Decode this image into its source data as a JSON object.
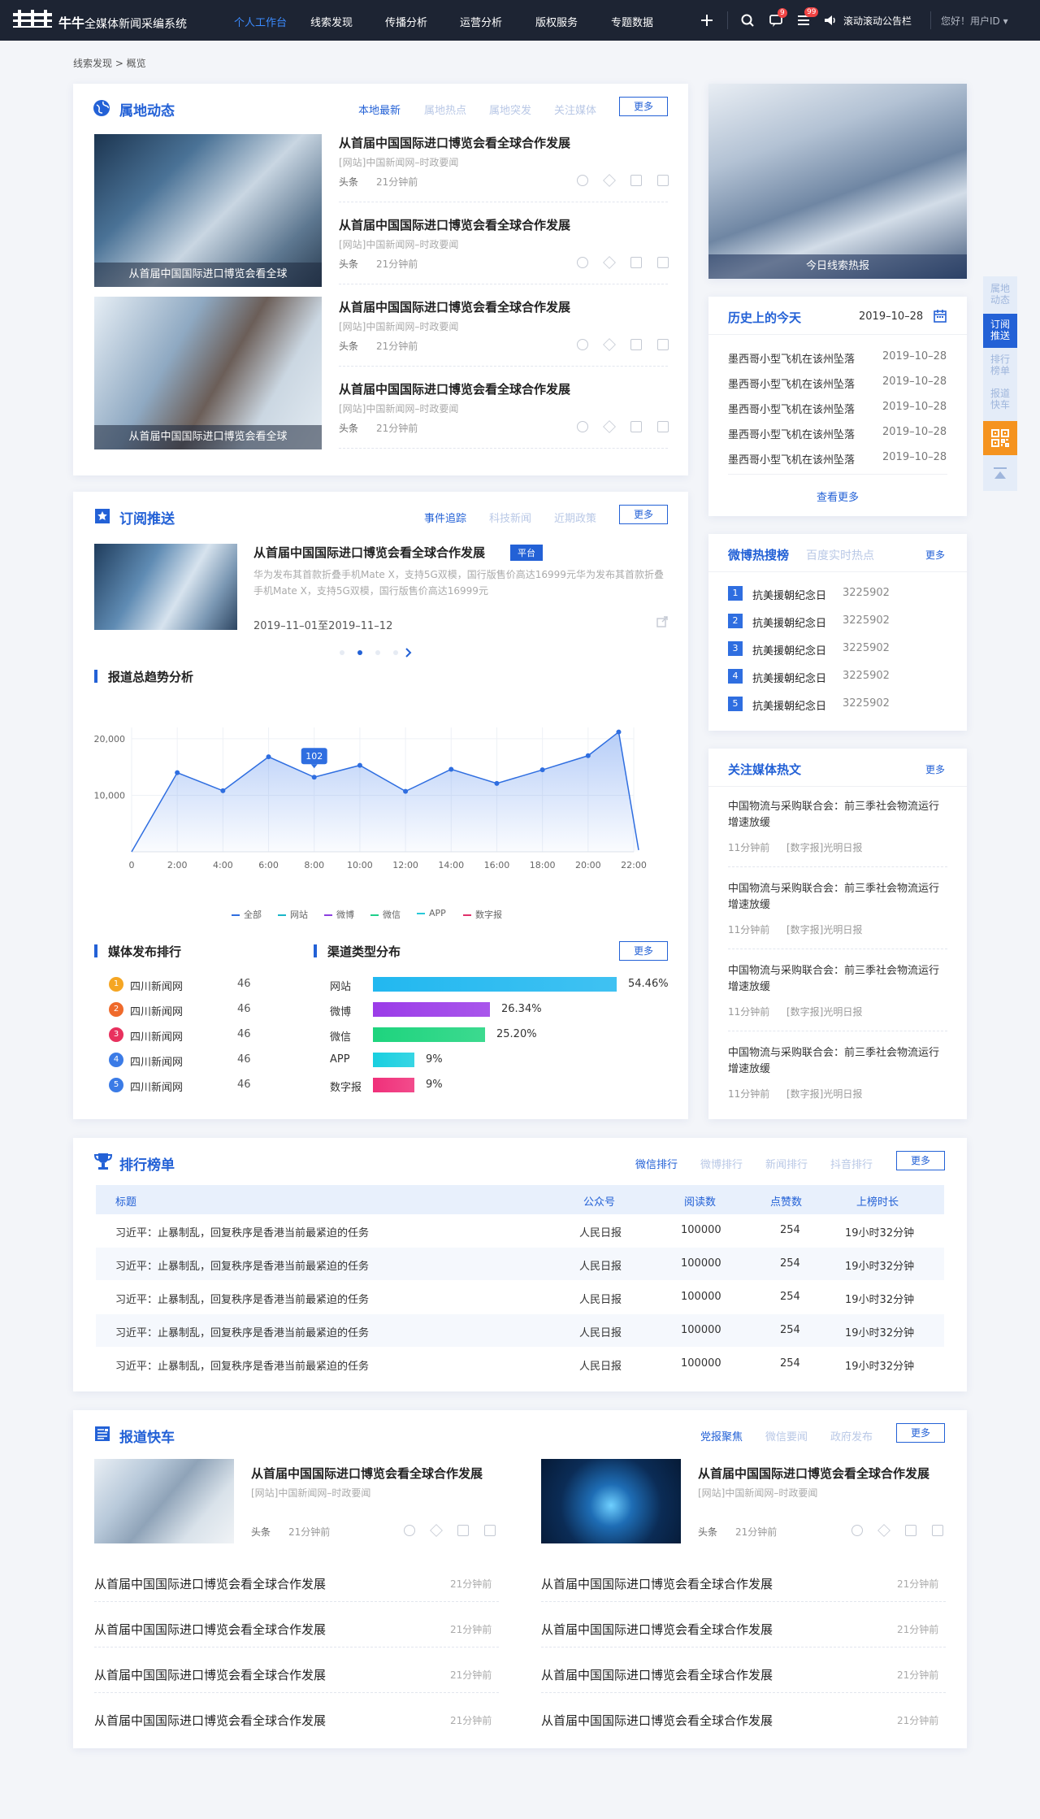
{
  "header": {
    "brand": "牛牛",
    "subtitle": "全媒体新闻采编系统",
    "nav": [
      "个人工作台",
      "线索发现",
      "传播分析",
      "运营分析",
      "版权服务",
      "专题数据"
    ],
    "active_nav": "个人工作台",
    "message_badge": "9",
    "list_badge": "99",
    "announcement": "滚动滚动公告栏",
    "user": "您好！用户ID"
  },
  "breadcrumb": "线索发现 > 概览",
  "local": {
    "title": "属地动态",
    "tabs": [
      "本地最新",
      "属地热点",
      "属地突发",
      "关注媒体"
    ],
    "more": "更多",
    "image_captions": [
      "从首届中国国际进口博览会看全球",
      "从首届中国国际进口博览会看全球"
    ],
    "items": [
      {
        "title": "从首届中国国际进口博览会看全球合作发展",
        "source": "[网站]中国新闻网–时政要闻",
        "tag": "头条",
        "time": "21分钟前"
      },
      {
        "title": "从首届中国国际进口博览会看全球合作发展",
        "source": "[网站]中国新闻网–时政要闻",
        "tag": "头条",
        "time": "21分钟前"
      },
      {
        "title": "从首届中国国际进口博览会看全球合作发展",
        "source": "[网站]中国新闻网–时政要闻",
        "tag": "头条",
        "time": "21分钟前"
      },
      {
        "title": "从首届中国国际进口博览会看全球合作发展",
        "source": "[网站]中国新闻网–时政要闻",
        "tag": "头条",
        "time": "21分钟前"
      }
    ]
  },
  "hot_banner": "今日线索热报",
  "history": {
    "title": "历史上的今天",
    "date": "2019–10–28",
    "items": [
      {
        "text": "墨西哥小型飞机在该州坠落",
        "date": "2019–10–28"
      },
      {
        "text": "墨西哥小型飞机在该州坠落",
        "date": "2019–10–28"
      },
      {
        "text": "墨西哥小型飞机在该州坠落",
        "date": "2019–10–28"
      },
      {
        "text": "墨西哥小型飞机在该州坠落",
        "date": "2019–10–28"
      },
      {
        "text": "墨西哥小型飞机在该州坠落",
        "date": "2019–10–28"
      }
    ],
    "more": "查看更多"
  },
  "subscribe": {
    "title": "订阅推送",
    "tabs": [
      "事件追踪",
      "科技新闻",
      "近期政策"
    ],
    "more": "更多",
    "headline": "从首届中国国际进口博览会看全球合作发展",
    "badge": "平台",
    "summary": "华为发布其首款折叠手机Mate X，支持5G双模，国行版售价高达16999元华为发布其首款折叠手机Mate X，支持5G双模，国行版售价高达16999元",
    "range": "2019–11–01至2019–11–12"
  },
  "weibo": {
    "title": "微博热搜榜",
    "tab2": "百度实时热点",
    "more": "更多",
    "items": [
      {
        "rank": "1",
        "text": "抗美援朝纪念日",
        "value": "3225902"
      },
      {
        "rank": "2",
        "text": "抗美援朝纪念日",
        "value": "3225902"
      },
      {
        "rank": "3",
        "text": "抗美援朝纪念日",
        "value": "3225902"
      },
      {
        "rank": "4",
        "text": "抗美援朝纪念日",
        "value": "3225902"
      },
      {
        "rank": "5",
        "text": "抗美援朝纪念日",
        "value": "3225902"
      }
    ]
  },
  "trend": {
    "title": "报道总趋势分析",
    "tooltip": "102",
    "legend": [
      "全部",
      "网站",
      "微博",
      "微信",
      "APP",
      "数字报"
    ],
    "legend_colors": [
      "#2f6ee0",
      "#19b6c8",
      "#8b3fe0",
      "#1fcf8a",
      "#27c9d9",
      "#e0306a"
    ]
  },
  "chart_data": {
    "type": "area",
    "x": [
      "0",
      "2:00",
      "4:00",
      "6:00",
      "8:00",
      "10:00",
      "12:00",
      "14:00",
      "16:00",
      "18:00",
      "20:00",
      "22:00"
    ],
    "series": [
      {
        "name": "全部",
        "values": [
          0,
          14000,
          10800,
          16800,
          13200,
          15300,
          10700,
          14600,
          12100,
          14500,
          17000,
          21200,
          300
        ]
      }
    ],
    "yticks": [
      "20,000",
      "10,000"
    ],
    "ylim": [
      0,
      22000
    ]
  },
  "media": {
    "title": "媒体发布排行",
    "items": [
      {
        "rank": "1",
        "name": "四川新闻网",
        "value": "46"
      },
      {
        "rank": "2",
        "name": "四川新闻网",
        "value": "46"
      },
      {
        "rank": "3",
        "name": "四川新闻网",
        "value": "46"
      },
      {
        "rank": "4",
        "name": "四川新闻网",
        "value": "46"
      },
      {
        "rank": "5",
        "name": "四川新闻网",
        "value": "46"
      }
    ]
  },
  "channel": {
    "title": "渠道类型分布",
    "more": "更多",
    "items": [
      {
        "name": "网站",
        "pct": "54.46%",
        "fraction": 1.0,
        "color": "#22b8f0"
      },
      {
        "name": "微博",
        "pct": "26.34%",
        "fraction": 0.48,
        "color": "#9b3ce8"
      },
      {
        "name": "微信",
        "pct": "25.20%",
        "fraction": 0.46,
        "color": "#1ed47e"
      },
      {
        "name": "APP",
        "pct": "9%",
        "fraction": 0.17,
        "color": "#19cfe0"
      },
      {
        "name": "数字报",
        "pct": "9%",
        "fraction": 0.17,
        "color": "#f0307a"
      }
    ]
  },
  "media_hot": {
    "title": "关注媒体热文",
    "more": "更多",
    "items": [
      {
        "title": "中国物流与采购联合会：前三季社会物流运行增速放缓",
        "time": "11分钟前",
        "src": "[数字报]光明日报"
      },
      {
        "title": "中国物流与采购联合会：前三季社会物流运行增速放缓",
        "time": "11分钟前",
        "src": "[数字报]光明日报"
      },
      {
        "title": "中国物流与采购联合会：前三季社会物流运行增速放缓",
        "time": "11分钟前",
        "src": "[数字报]光明日报"
      },
      {
        "title": "中国物流与采购联合会：前三季社会物流运行增速放缓",
        "time": "11分钟前",
        "src": "[数字报]光明日报"
      }
    ]
  },
  "ranking": {
    "title": "排行榜单",
    "tabs": [
      "微信排行",
      "微博排行",
      "新闻排行",
      "抖音排行"
    ],
    "more": "更多",
    "columns": [
      "标题",
      "公众号",
      "阅读数",
      "点赞数",
      "上榜时长"
    ],
    "rows": [
      [
        "习近平：止暴制乱，回复秩序是香港当前最紧迫的任务",
        "人民日报",
        "100000",
        "254",
        "19小时32分钟"
      ],
      [
        "习近平：止暴制乱，回复秩序是香港当前最紧迫的任务",
        "人民日报",
        "100000",
        "254",
        "19小时32分钟"
      ],
      [
        "习近平：止暴制乱，回复秩序是香港当前最紧迫的任务",
        "人民日报",
        "100000",
        "254",
        "19小时32分钟"
      ],
      [
        "习近平：止暴制乱，回复秩序是香港当前最紧迫的任务",
        "人民日报",
        "100000",
        "254",
        "19小时32分钟"
      ],
      [
        "习近平：止暴制乱，回复秩序是香港当前最紧迫的任务",
        "人民日报",
        "100000",
        "254",
        "19小时32分钟"
      ]
    ]
  },
  "express": {
    "title": "报道快车",
    "tabs": [
      "党报聚焦",
      "微信要闻",
      "政府发布"
    ],
    "more": "更多",
    "cards": [
      {
        "title": "从首届中国国际进口博览会看全球合作发展",
        "source": "[网站]中国新闻网–时政要闻",
        "tag": "头条",
        "time": "21分钟前"
      },
      {
        "title": "从首届中国国际进口博览会看全球合作发展",
        "source": "[网站]中国新闻网–时政要闻",
        "tag": "头条",
        "time": "21分钟前"
      }
    ],
    "list_left": [
      {
        "title": "从首届中国国际进口博览会看全球合作发展",
        "time": "21分钟前"
      },
      {
        "title": "从首届中国国际进口博览会看全球合作发展",
        "time": "21分钟前"
      },
      {
        "title": "从首届中国国际进口博览会看全球合作发展",
        "time": "21分钟前"
      },
      {
        "title": "从首届中国国际进口博览会看全球合作发展",
        "time": "21分钟前"
      }
    ],
    "list_right": [
      {
        "title": "从首届中国国际进口博览会看全球合作发展",
        "time": "21分钟前"
      },
      {
        "title": "从首届中国国际进口博览会看全球合作发展",
        "time": "21分钟前"
      },
      {
        "title": "从首届中国国际进口博览会看全球合作发展",
        "time": "21分钟前"
      },
      {
        "title": "从首届中国国际进口博览会看全球合作发展",
        "time": "21分钟前"
      }
    ]
  },
  "sidebar": {
    "items": [
      {
        "label": "属地动态",
        "active": false
      },
      {
        "label": "订阅推送",
        "active": true
      },
      {
        "label": "排行榜单",
        "active": false
      },
      {
        "label": "报道快车",
        "active": false
      }
    ]
  }
}
